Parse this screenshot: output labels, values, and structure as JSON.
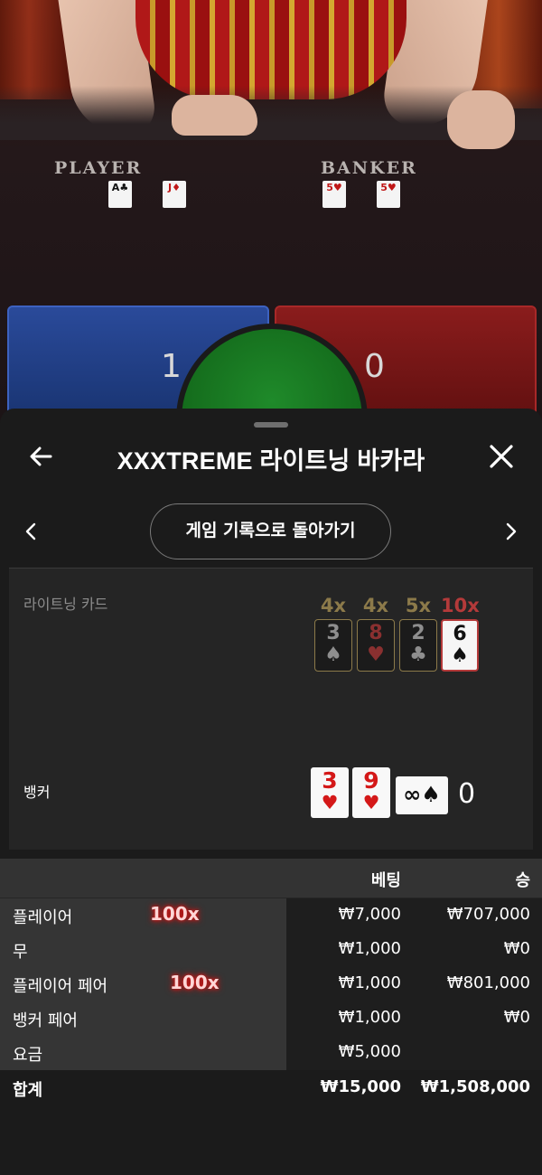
{
  "video": {
    "player_label": "PLAYER",
    "banker_label": "BANKER",
    "player_cards": [
      {
        "rank": "A",
        "suit": "♣",
        "color": "black"
      },
      {
        "rank": "J",
        "suit": "♦",
        "color": "red"
      }
    ],
    "banker_cards": [
      {
        "rank": "5",
        "suit": "♥",
        "color": "red"
      },
      {
        "rank": "5",
        "suit": "♥",
        "color": "red"
      }
    ],
    "player_score": "1",
    "banker_score": "0"
  },
  "sheet": {
    "title": "XXXTREME 라이트닝 바카라",
    "back_button": "←",
    "history_button": "게임 기록으로 돌아가기",
    "lightning_label": "라이트닝 카드",
    "lightning_cards": [
      {
        "mult": "4x",
        "rank": "3",
        "suit": "♠",
        "mult_color": "#8c7a4a",
        "style": "dim"
      },
      {
        "mult": "4x",
        "rank": "8",
        "suit": "♥",
        "mult_color": "#8c7a4a",
        "style": "dim red"
      },
      {
        "mult": "5x",
        "rank": "2",
        "suit": "♣",
        "mult_color": "#8c7a4a",
        "style": "dim"
      },
      {
        "mult": "10x",
        "rank": "6",
        "suit": "♠",
        "mult_color": "#b43a3a",
        "style": "bright"
      }
    ],
    "banker_label": "뱅커",
    "banker_cards": [
      {
        "rank": "3",
        "suit": "♥"
      },
      {
        "rank": "9",
        "suit": "♥"
      }
    ],
    "infinity_card": "∞♠",
    "banker_hand_score": "0"
  },
  "bets": {
    "header_bet": "베팅",
    "header_win": "승",
    "rows": [
      {
        "name": "플레이어",
        "multiplier": "100x",
        "bet": "₩7,000",
        "win": "₩707,000"
      },
      {
        "name": "무",
        "multiplier": "",
        "bet": "₩1,000",
        "win": "₩0"
      },
      {
        "name": "플레이어 페어",
        "multiplier": "100x",
        "bet": "₩1,000",
        "win": "₩801,000"
      },
      {
        "name": "뱅커 페어",
        "multiplier": "",
        "bet": "₩1,000",
        "win": "₩0"
      },
      {
        "name": "요금",
        "multiplier": "",
        "bet": "₩5,000",
        "win": ""
      }
    ],
    "total": {
      "name": "합계",
      "bet": "₩15,000",
      "win": "₩1,508,000"
    }
  }
}
